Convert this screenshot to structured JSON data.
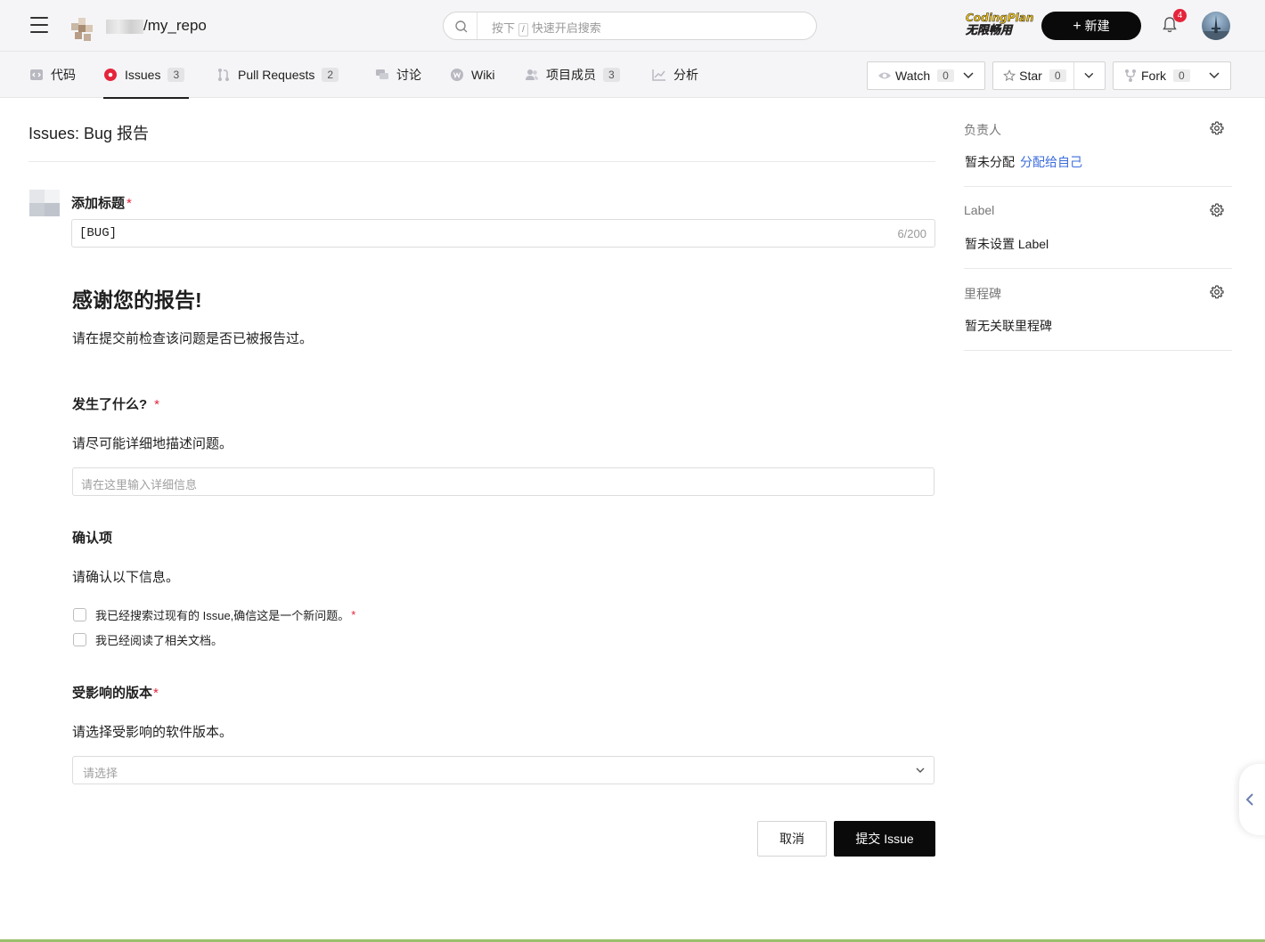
{
  "header": {
    "repo_path": "/my_repo",
    "search_prefix": "按下",
    "search_key": "/",
    "search_placeholder": "快速开启搜索",
    "badge_line1": "CodingPlan",
    "badge_line2": "无限畅用",
    "new_label": "新建",
    "notification_count": "4"
  },
  "tabs": [
    {
      "label": "代码",
      "icon": "code-icon"
    },
    {
      "label": "Issues",
      "count": "3",
      "icon": "issue-icon",
      "active": true
    },
    {
      "label": "Pull Requests",
      "count": "2",
      "icon": "pull-request-icon"
    },
    {
      "label": "讨论",
      "icon": "discussion-icon"
    },
    {
      "label": "Wiki",
      "icon": "wiki-icon"
    },
    {
      "label": "项目成员",
      "count": "3",
      "icon": "members-icon"
    },
    {
      "label": "分析",
      "icon": "analytics-icon"
    }
  ],
  "repo_actions": {
    "watch_label": "Watch",
    "watch_count": "0",
    "star_label": "Star",
    "star_count": "0",
    "fork_label": "Fork",
    "fork_count": "0"
  },
  "form": {
    "page_title": "Issues: Bug 报告",
    "title_label": "添加标题",
    "required_mark": "*",
    "title_value": "[BUG]",
    "title_counter": "6/200",
    "thanks_heading": "感谢您的报告!",
    "thanks_desc": "请在提交前检查该问题是否已被报告过。",
    "what_label": "发生了什么?",
    "what_desc": "请尽可能详细地描述问题。",
    "what_placeholder": "请在这里输入详细信息",
    "confirm_label": "确认项",
    "confirm_desc": "请确认以下信息。",
    "check1": "我已经搜索过现有的 Issue,确信这是一个新问题。",
    "check2": "我已经阅读了相关文档。",
    "version_label": "受影响的版本",
    "version_desc": "请选择受影响的软件版本。",
    "version_placeholder": "请选择",
    "cancel_label": "取消",
    "submit_label": "提交 Issue"
  },
  "sidebar": {
    "assignee_heading": "负责人",
    "assignee_value": "暂未分配",
    "assign_self": "分配给自己",
    "label_heading": "Label",
    "label_value": "暂未设置 Label",
    "milestone_heading": "里程碑",
    "milestone_value": "暂无关联里程碑"
  },
  "colors": {
    "primary": "#0a0a0a",
    "link": "#3b6cdb",
    "required": "#e5243b",
    "issue_icon": "#e5243b"
  }
}
